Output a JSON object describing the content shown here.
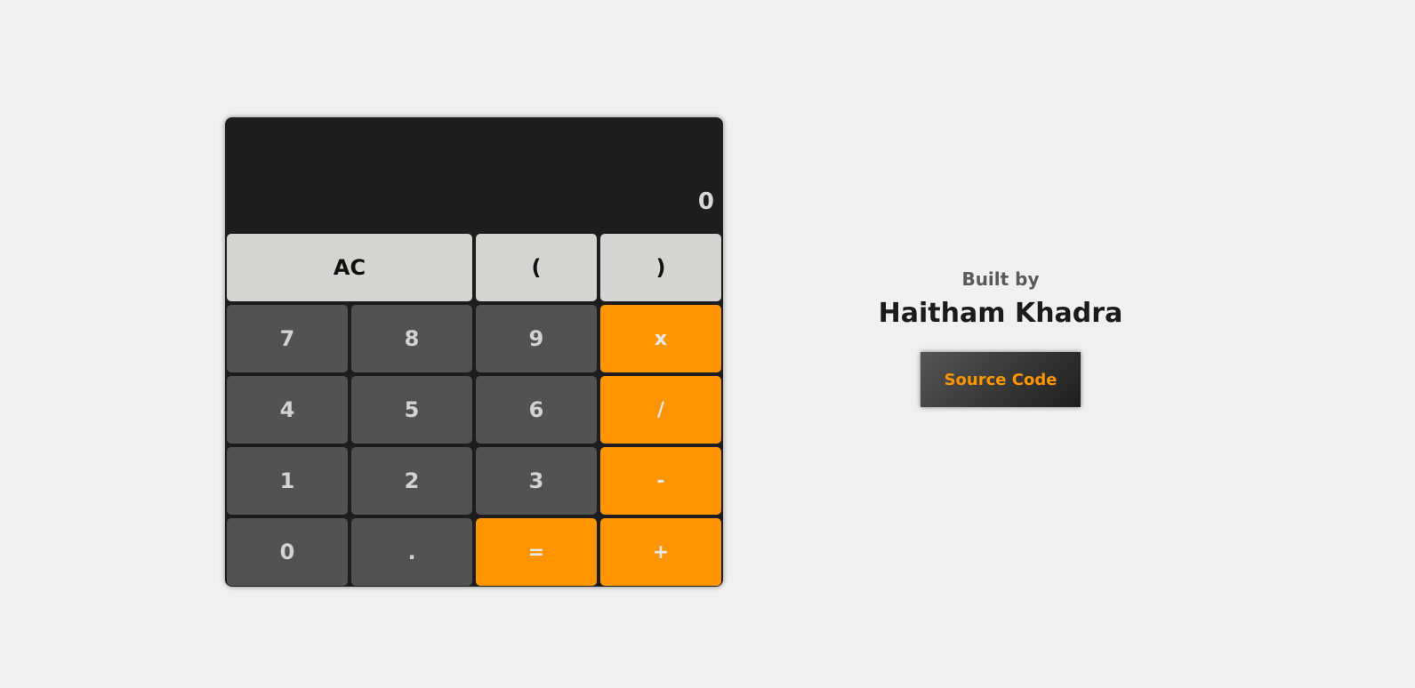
{
  "calculator": {
    "display": "0",
    "keys": [
      {
        "label": "AC",
        "kind": "fn"
      },
      {
        "label": "(",
        "kind": "fn"
      },
      {
        "label": ")",
        "kind": "fn"
      },
      {
        "label": "7",
        "kind": "num"
      },
      {
        "label": "8",
        "kind": "num"
      },
      {
        "label": "9",
        "kind": "num"
      },
      {
        "label": "x",
        "kind": "op"
      },
      {
        "label": "4",
        "kind": "num"
      },
      {
        "label": "5",
        "kind": "num"
      },
      {
        "label": "6",
        "kind": "num"
      },
      {
        "label": "/",
        "kind": "op"
      },
      {
        "label": "1",
        "kind": "num"
      },
      {
        "label": "2",
        "kind": "num"
      },
      {
        "label": "3",
        "kind": "num"
      },
      {
        "label": "-",
        "kind": "op"
      },
      {
        "label": "0",
        "kind": "num"
      },
      {
        "label": ".",
        "kind": "num"
      },
      {
        "label": "=",
        "kind": "op"
      },
      {
        "label": "+",
        "kind": "op"
      }
    ]
  },
  "credit": {
    "built_by": "Built by",
    "author": "Haitham Khadra",
    "source_button": "Source Code"
  },
  "colors": {
    "background": "#f0f0f0",
    "calculator_body": "#1d1d1d",
    "number_key": "#525252",
    "function_key": "#d4d4d2",
    "operator_key": "#ff9500",
    "accent": "#ff9500"
  }
}
